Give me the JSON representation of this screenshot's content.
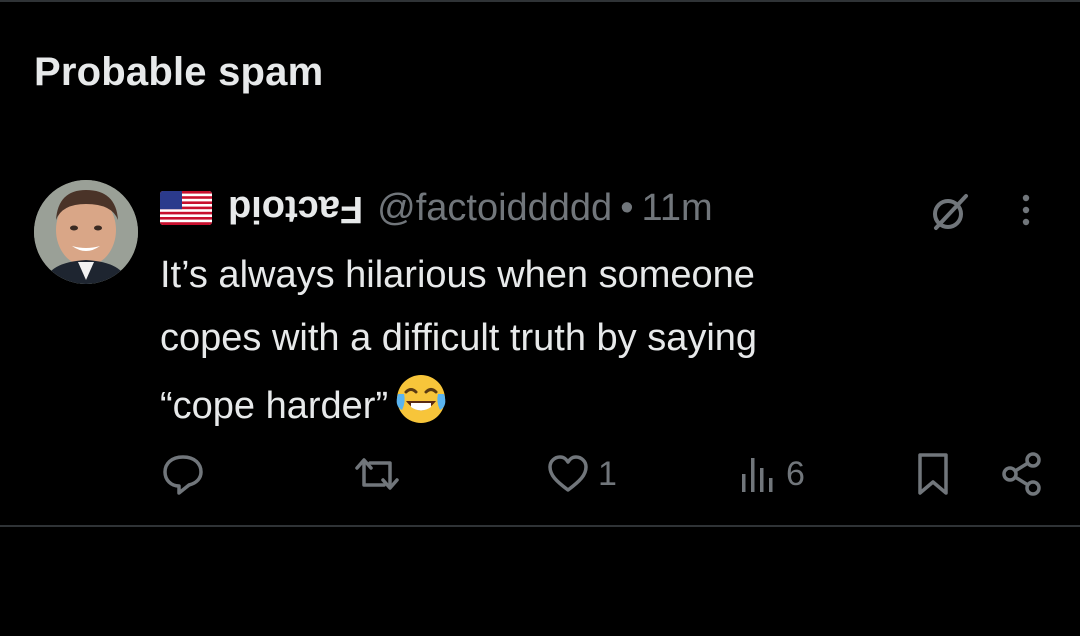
{
  "section": {
    "title": "Probable spam"
  },
  "tweet": {
    "flag_icon": "us-flag-icon",
    "display_name": "Factoid",
    "handle": "@factoiddddd",
    "separator": "•",
    "time": "11m",
    "text_lines": [
      "It’s always hilarious when someone",
      "copes with a difficult truth by saying",
      "“cope harder”"
    ],
    "emoji": "face-with-tears-of-joy",
    "actions": {
      "reply_icon": "reply-icon",
      "retweet_icon": "retweet-icon",
      "like_icon": "heart-icon",
      "like_count": "1",
      "views_icon": "views-icon",
      "views_count": "6",
      "bookmark_icon": "bookmark-icon",
      "share_icon": "share-icon"
    }
  },
  "colors": {
    "background": "#000000",
    "text": "#e7e9ea",
    "secondary": "#71767b",
    "divider": "#2f3336"
  }
}
